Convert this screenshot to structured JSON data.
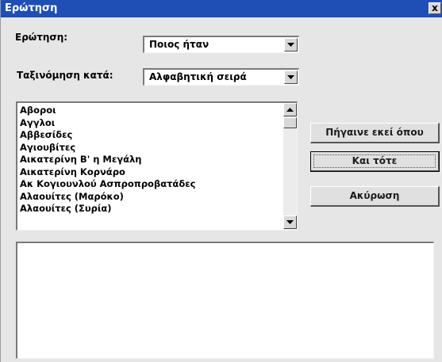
{
  "window": {
    "title": "Ερώτηση",
    "close_label": "x"
  },
  "form": {
    "question_label": "Ερώτηση:",
    "question_value": "Ποιος ήταν",
    "sort_label": "Ταξινόμηση κατά:",
    "sort_value": "Αλφαβητική σειρά"
  },
  "list": {
    "items": [
      "Αβοροι",
      "Αγγλοι",
      "Αββεσίδες",
      "Αγιουβίτες",
      "Αικατερίνη Β' η Μεγάλη",
      "Αικατερίνη Κορνάρο",
      "Ακ Κογιουνλού Ασπροπροβατάδες",
      "Αλαουίτες (Μαρόκο)",
      "Αλαουίτες (Συρία)"
    ]
  },
  "buttons": {
    "goto_label": "Πήγαινε εκεί όπου",
    "then_label": "Και τότε",
    "clear_label": "Ακύρωση"
  },
  "result": {
    "text": ""
  },
  "colors": {
    "titlebar": "#1f4fb5",
    "dialog_bg": "#e6e6e6"
  }
}
